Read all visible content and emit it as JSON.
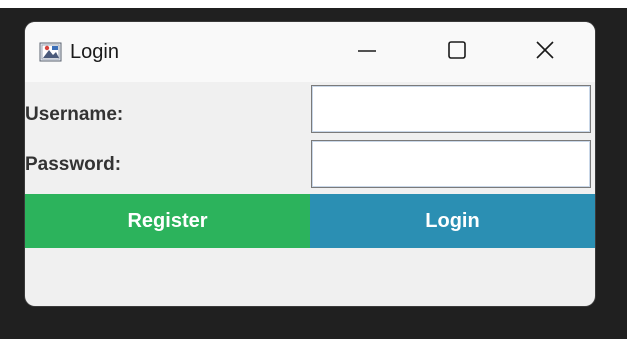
{
  "window": {
    "title": "Login"
  },
  "titlebar": {
    "app_icon": "login-app-icon",
    "minimize_icon": "minimize-icon",
    "maximize_icon": "maximize-icon",
    "close_icon": "close-icon"
  },
  "form": {
    "username_label": "Username:",
    "username_value": "",
    "password_label": "Password:",
    "password_value": ""
  },
  "buttons": {
    "register_label": "Register",
    "login_label": "Login"
  },
  "colors": {
    "register": "#2cb35c",
    "login": "#2b8fb3",
    "window_bg": "#f0f0f0"
  }
}
